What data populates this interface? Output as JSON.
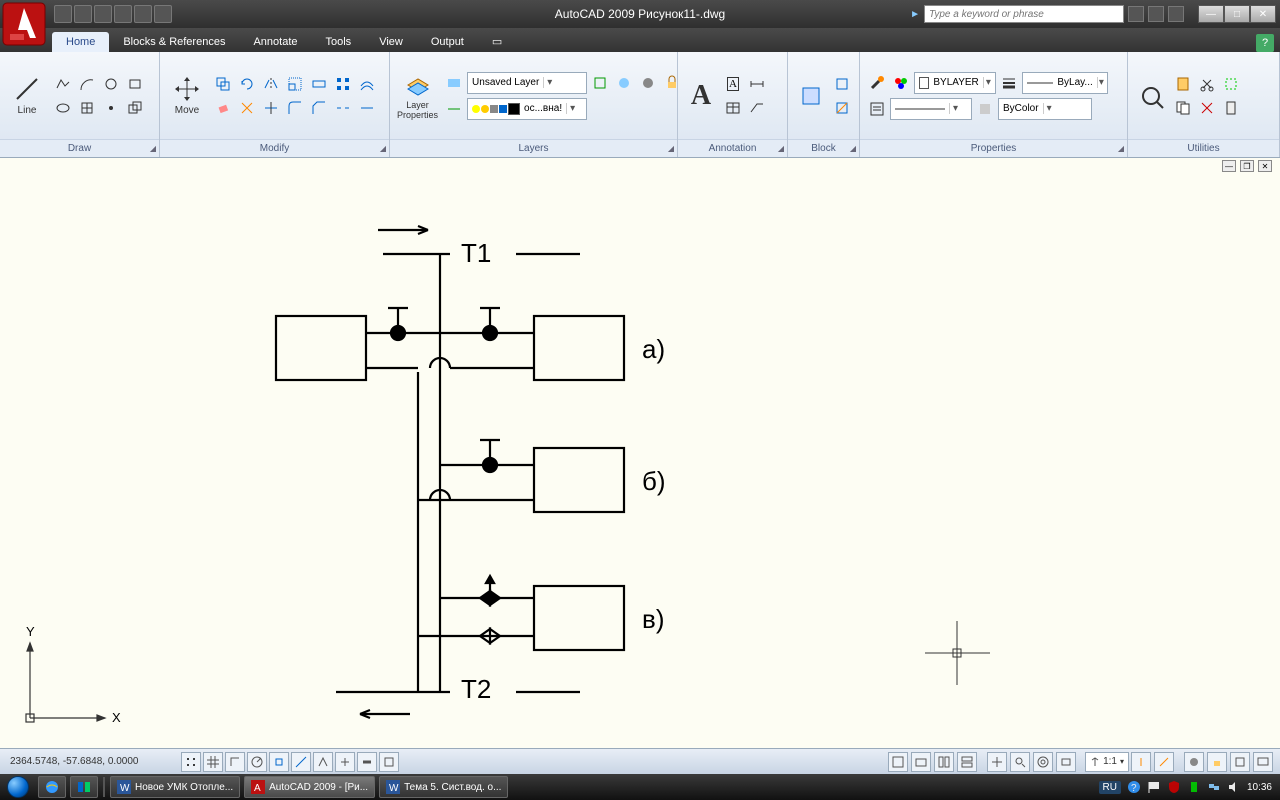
{
  "title": "AutoCAD 2009 Рисунок11-.dwg",
  "search_placeholder": "Type a keyword or phrase",
  "tabs": [
    "Home",
    "Blocks & References",
    "Annotate",
    "Tools",
    "View",
    "Output"
  ],
  "panels": {
    "draw": {
      "title": "Draw",
      "line": "Line"
    },
    "modify": {
      "title": "Modify",
      "move": "Move"
    },
    "layers": {
      "title": "Layers",
      "props": "Layer\nProperties",
      "unsaved": "Unsaved Layer",
      "current": "ос...вна!"
    },
    "annotation": {
      "title": "Annotation"
    },
    "block": {
      "title": "Block"
    },
    "properties": {
      "title": "Properties",
      "bylayer": "BYLAYER",
      "bylay": "ByLay...",
      "bycolor": "ByColor"
    },
    "utilities": {
      "title": "Utilities"
    }
  },
  "drawing": {
    "t1": "T1",
    "t2": "T2",
    "a": "а)",
    "b": "б)",
    "v": "в)"
  },
  "status": {
    "coords": "2364.5748, -57.6848, 0.0000",
    "scale": "1:1"
  },
  "taskbar": {
    "t1": "Новое УМК Отопле...",
    "t2": "AutoCAD 2009 - [Ри...",
    "t3": "Тема 5. Сист.вод. о...",
    "lang": "RU",
    "time": "10:36"
  }
}
